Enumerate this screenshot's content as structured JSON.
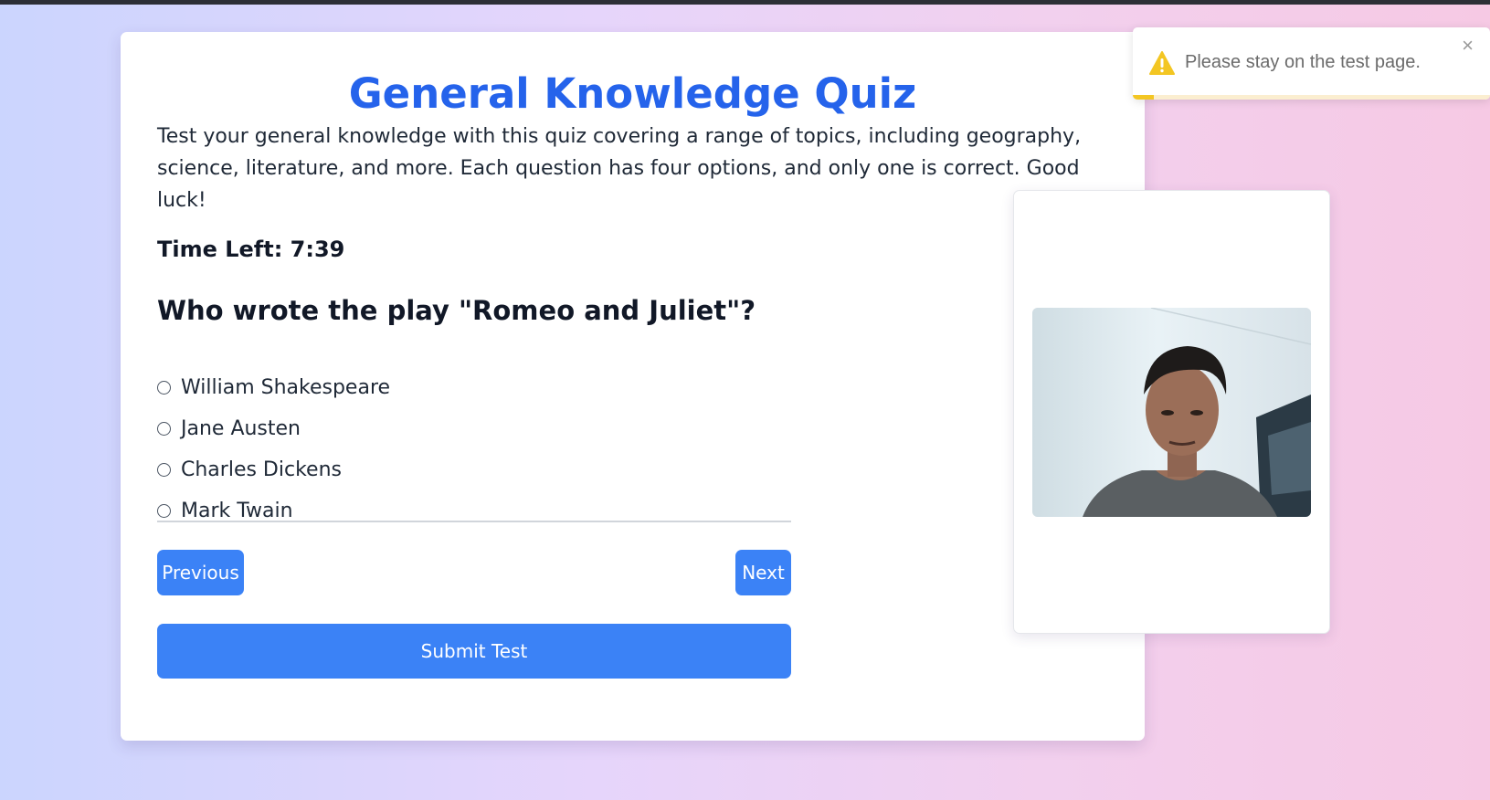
{
  "quiz": {
    "title": "General Knowledge Quiz",
    "description": "Test your general knowledge with this quiz covering a range of topics, including geography, science, literature, and more. Each question has four options, and only one is correct. Good luck!",
    "timer": "Time Left: 7:39",
    "question": "Who wrote the play \"Romeo and Juliet\"?",
    "options": [
      "William Shakespeare",
      "Jane Austen",
      "Charles Dickens",
      "Mark Twain"
    ],
    "previous_label": "Previous",
    "next_label": "Next",
    "submit_label": "Submit Test"
  },
  "webcam": {
    "feed": "webcam-feed-person"
  },
  "toast": {
    "icon": "warning-icon",
    "message": "Please stay on the test page.",
    "close_symbol": "×",
    "progress_remaining": 0.06
  },
  "colors": {
    "accent": "#3b82f6",
    "title": "#2563eb",
    "warning": "#f3c623"
  }
}
